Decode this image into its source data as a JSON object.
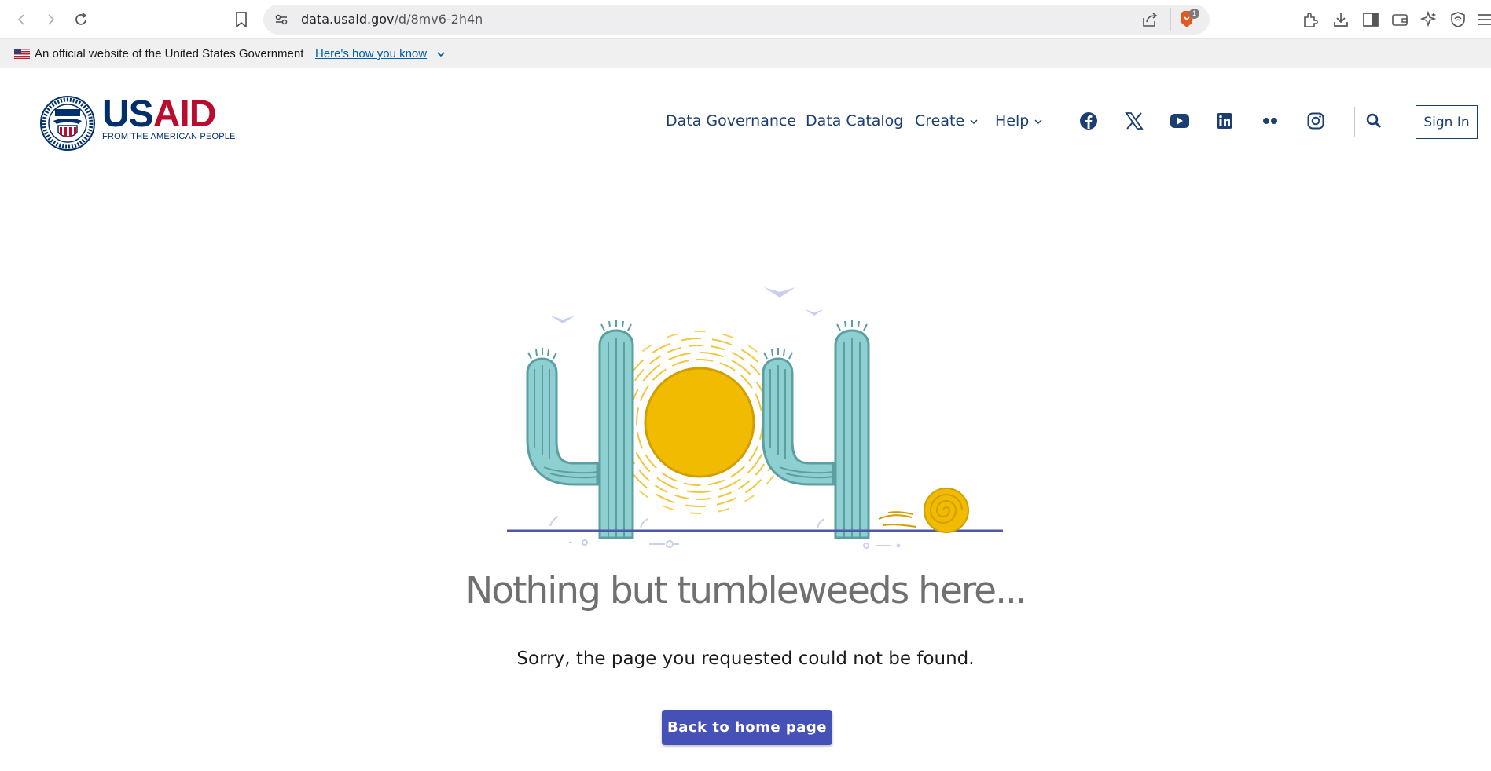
{
  "browser": {
    "url_domain": "data.usaid.gov",
    "url_path": "/d/8mv6-2h4n",
    "brave_badge": "1"
  },
  "gov_banner": {
    "text": "An official website of the United States Government",
    "link": "Here's how you know"
  },
  "logo": {
    "main_us": "US",
    "main_aid": "AID",
    "tagline": "FROM THE AMERICAN PEOPLE"
  },
  "nav": {
    "items": [
      {
        "label": "Data Governance"
      },
      {
        "label": "Data Catalog"
      },
      {
        "label": "Create"
      },
      {
        "label": "Help"
      }
    ],
    "social_icons": [
      "facebook-icon",
      "x-icon",
      "youtube-icon",
      "linkedin-icon",
      "flickr-icon",
      "instagram-icon"
    ],
    "sign_in": "Sign In"
  },
  "main": {
    "headline": "Nothing but tumbleweeds here...",
    "subtext": "Sorry, the page you requested could not be found.",
    "button": "Back to home page"
  },
  "colors": {
    "nav_text": "#1c3f72",
    "button_bg": "#4651b8",
    "cactus": "#8ecfd1",
    "sun": "#f0bb00",
    "usaid_red": "#ba0c2f",
    "usaid_blue": "#002f6c"
  }
}
